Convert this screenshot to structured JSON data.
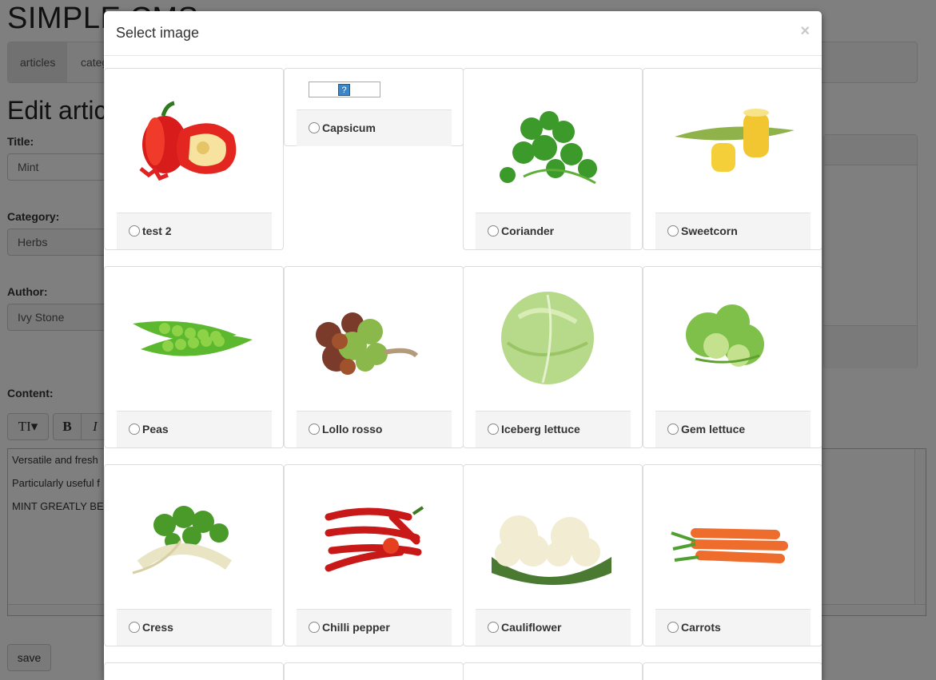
{
  "background": {
    "app_title": "SIMPLE CMS",
    "nav": [
      "articles",
      "categ"
    ],
    "heading": "Edit artic",
    "title_label": "Title:",
    "title_value": "Mint",
    "category_label": "Category:",
    "category_value": "Herbs",
    "author_label": "Author:",
    "author_value": "Ivy Stone",
    "content_label": "Content:",
    "toolbar": [
      "TI▾",
      "B",
      "I"
    ],
    "content_lines": [
      "Versatile and fresh",
      "Particularly useful f",
      "MINT GREATLY BE"
    ],
    "save_label": "save"
  },
  "modal": {
    "title": "Select image",
    "close": "×",
    "images": [
      {
        "label": "test 2",
        "image": "red-pepper"
      },
      {
        "label": "Capsicum",
        "image": "broken",
        "broken_glyph": "?"
      },
      {
        "label": "Coriander",
        "image": "coriander"
      },
      {
        "label": "Sweetcorn",
        "image": "sweetcorn"
      },
      {
        "label": "Peas",
        "image": "peas"
      },
      {
        "label": "Lollo rosso",
        "image": "lollo-rosso"
      },
      {
        "label": "Iceberg lettuce",
        "image": "iceberg-lettuce"
      },
      {
        "label": "Gem lettuce",
        "image": "gem-lettuce"
      },
      {
        "label": "Cress",
        "image": "cress"
      },
      {
        "label": "Chilli pepper",
        "image": "chilli-pepper"
      },
      {
        "label": "Cauliflower",
        "image": "cauliflower"
      },
      {
        "label": "Carrots",
        "image": "carrots"
      }
    ]
  }
}
